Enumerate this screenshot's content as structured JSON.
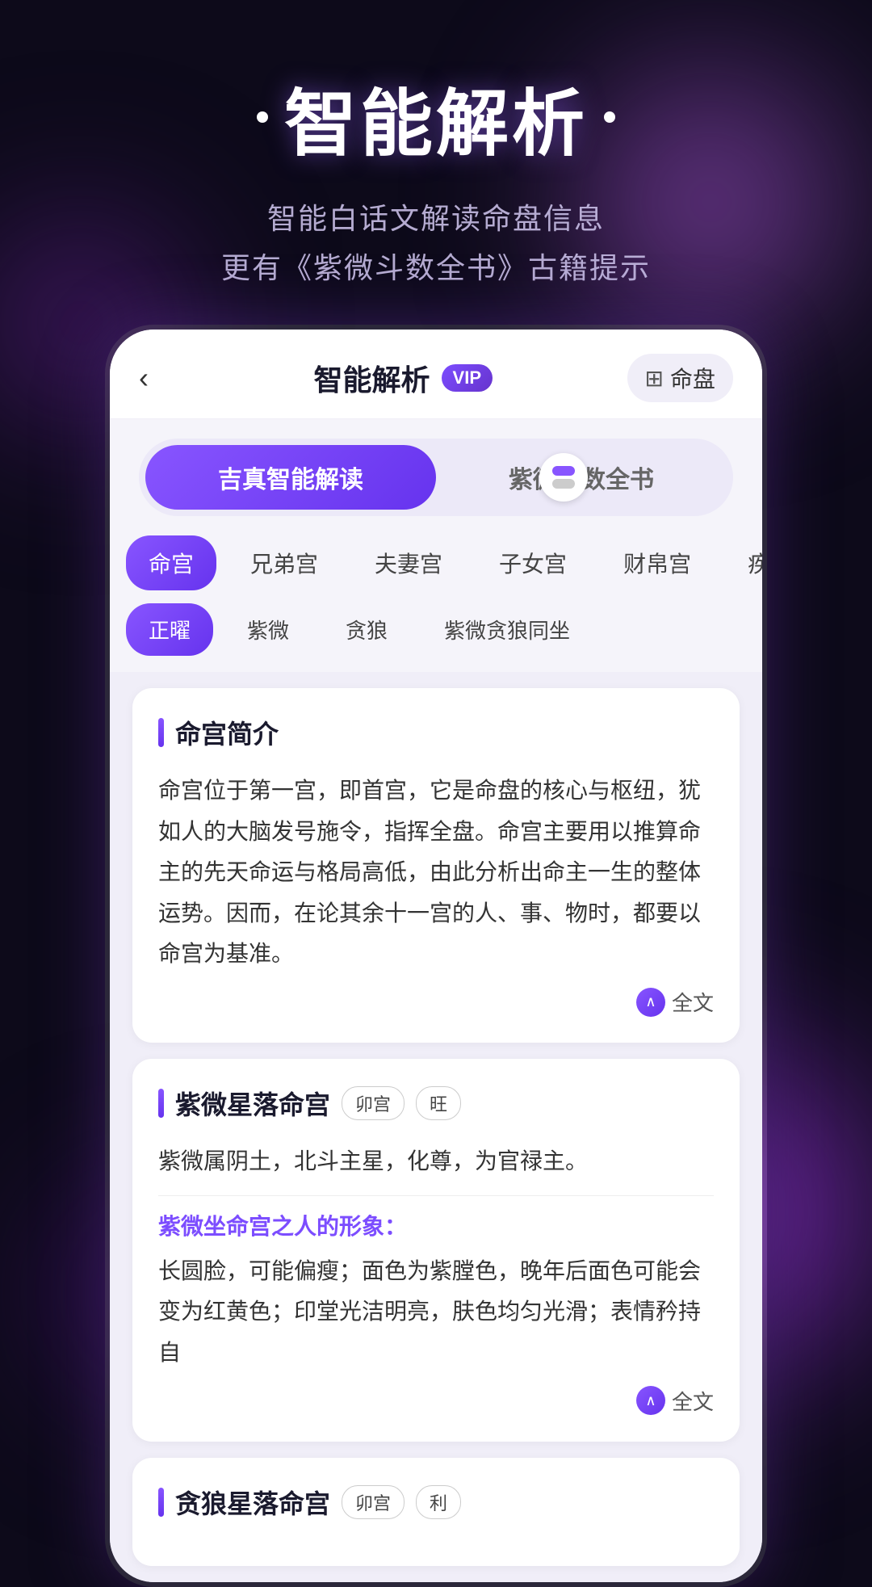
{
  "background": {
    "color": "#0d0a1a"
  },
  "header": {
    "title": "智能解析",
    "dot_left": "•",
    "dot_right": "•",
    "subtitle_line1": "智能白话文解读命盘信息",
    "subtitle_line2": "更有《紫微斗数全书》古籍提示"
  },
  "app": {
    "back_icon": "‹",
    "nav_title": "智能解析",
    "vip_label": "VIP",
    "mingpan_icon": "⊞",
    "mingpan_label": "命盘",
    "toggle": {
      "left_label": "吉真智能解读",
      "right_label": "紫微斗数全书"
    },
    "category_tabs": [
      {
        "label": "命宫",
        "active": true
      },
      {
        "label": "兄弟宫",
        "active": false
      },
      {
        "label": "夫妻宫",
        "active": false
      },
      {
        "label": "子女宫",
        "active": false
      },
      {
        "label": "财帛宫",
        "active": false
      },
      {
        "label": "疾",
        "active": false
      }
    ],
    "sub_tabs": [
      {
        "label": "正曜",
        "active": true
      },
      {
        "label": "紫微",
        "active": false
      },
      {
        "label": "贪狼",
        "active": false
      },
      {
        "label": "紫微贪狼同坐",
        "active": false
      }
    ],
    "cards": [
      {
        "id": "mingong-jianjie",
        "title": "命宫简介",
        "badges": [],
        "body": "命宫位于第一宫，即首宫，它是命盘的核心与枢纽，犹如人的大脑发号施令，指挥全盘。命宫主要用以推算命主的先天命运与格局高低，由此分析出命主一生的整体运势。因而，在论其余十一宫的人、事、物时，都要以命宫为基准。",
        "read_more": "全文",
        "link_text": ""
      },
      {
        "id": "ziwei-luoming",
        "title": "紫微星落命宫",
        "badges": [
          "卯宫",
          "旺"
        ],
        "body_plain": "紫微属阴土，北斗主星，化尊，为官禄主。",
        "link_text": "紫微坐命宫之人的形象：",
        "body_link": "长圆脸，可能偏瘦；面色为紫膛色，晚年后面色可能会变为红黄色；印堂光洁明亮，肤色均匀光滑；表情矜持自",
        "read_more": "全文"
      },
      {
        "id": "tanlang-luoming",
        "title": "贪狼星落命宫",
        "badges": [
          "卯宫",
          "利"
        ],
        "body": "",
        "read_more": ""
      }
    ]
  }
}
